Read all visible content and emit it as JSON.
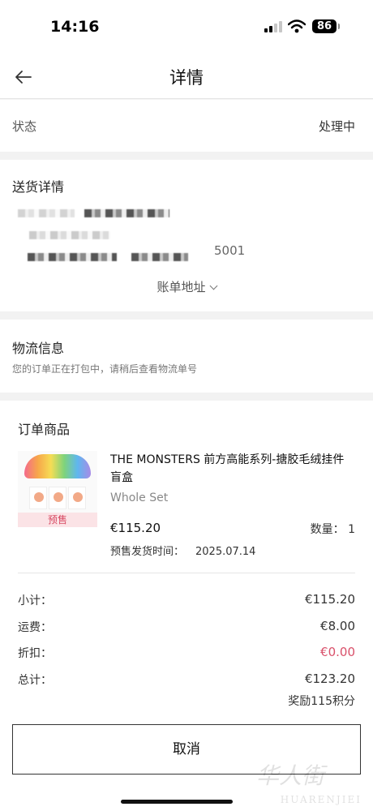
{
  "status_bar": {
    "time": "14:16",
    "battery": "86"
  },
  "nav": {
    "title": "详情"
  },
  "status": {
    "label": "状态",
    "value": "处理中"
  },
  "shipping": {
    "heading": "送货详情",
    "address_tail": "5001",
    "toggle_label": "账单地址"
  },
  "logistics": {
    "heading": "物流信息",
    "note": "您的订单正在打包中，请稍后查看物流单号"
  },
  "order": {
    "heading": "订单商品",
    "product": {
      "name": "THE MONSTERS 前方高能系列-搪胶毛绒挂件盲盒",
      "variant": "Whole Set",
      "badge": "预售",
      "price": "€115.20",
      "qty_label": "数量：",
      "qty": "1",
      "presale_label": "预售发货时间：",
      "presale_date": "2025.07.14"
    },
    "summary": {
      "subtotal_label": "小计：",
      "subtotal": "€115.20",
      "shipping_label": "运费：",
      "shipping": "€8.00",
      "discount_label": "折扣：",
      "discount": "€0.00",
      "total_label": "总计：",
      "total": "€123.20",
      "reward": "奖励115积分"
    },
    "cancel_label": "取消"
  },
  "colors": {
    "discount": "#d9506a",
    "presale_badge_bg": "#fbe3e6",
    "presale_badge_text": "#d84a63"
  },
  "icons": [
    "back-arrow-icon",
    "chevron-down-icon",
    "signal-icon",
    "wifi-icon",
    "battery-icon"
  ]
}
